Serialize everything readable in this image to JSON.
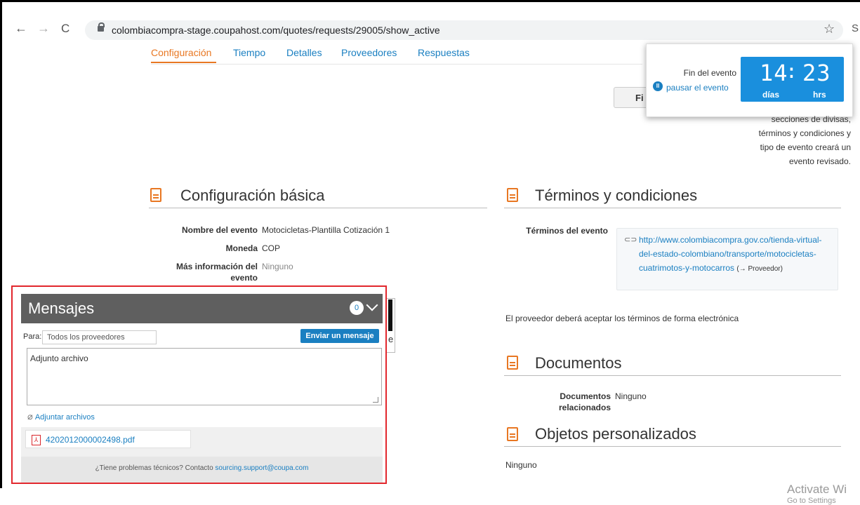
{
  "browser": {
    "url": "colombiacompra-stage.coupahost.com/quotes/requests/29005/show_active",
    "back": "←",
    "forward": "→",
    "reload": "C",
    "star": "☆",
    "extension": "S"
  },
  "tabs": [
    {
      "label": "Configuración",
      "active": true
    },
    {
      "label": "Tiempo"
    },
    {
      "label": "Detalles"
    },
    {
      "label": "Proveedores"
    },
    {
      "label": "Respuestas"
    }
  ],
  "timer": {
    "label": "Fin del evento",
    "pause_link": "pausar el evento",
    "days_value": "14",
    "hours_value": "23",
    "days_unit": "días",
    "hours_unit": "hrs",
    "background_color": "#1a8fdd"
  },
  "fin_button_label": "Fi",
  "revised_note_lines": [
    "secciones de divisas,",
    "términos y condiciones y",
    "tipo de evento creará un",
    "evento revisado."
  ],
  "basic_config": {
    "title": "Configuración básica",
    "fields": [
      {
        "label": "Nombre del evento",
        "value": "Motocicletas-Plantilla Cotización 1"
      },
      {
        "label": "Moneda",
        "value": "COP"
      },
      {
        "label": "Más información del evento",
        "value": "Ninguno"
      }
    ]
  },
  "terms": {
    "title": "Términos y condiciones",
    "label": "Términos del evento",
    "link": "http://www.colombiacompra.gov.co/tienda-virtual-del-estado-colombiano/transporte/motocicletas-cuatrimotos-y-motocarros",
    "link_note": "(→ Proveedor)",
    "accept_note": "El proveedor deberá aceptar los términos de forma electrónica"
  },
  "documents": {
    "title": "Documentos",
    "label": "Documentos relacionados",
    "value": "Ninguno"
  },
  "custom_objects": {
    "title": "Objetos personalizados",
    "value": "Ninguno"
  },
  "messages": {
    "title": "Mensajes",
    "count": "0",
    "to_label": "Para:",
    "to_value": "Todos los proveedores",
    "send_label": "Enviar un mensaje",
    "body_text": "Adjunto archivo",
    "attach_label": "Adjuntar archivos",
    "attached_file": "4202012000002498.pdf",
    "footer_text": "¿Tiene problemas técnicos? Contacto",
    "footer_email": "sourcing.support@coupa.com",
    "highlight_color": "#e2272d"
  },
  "under_panel_text": "e",
  "watermark": {
    "line1": "Activate Wi",
    "line2": "Go to Settings"
  }
}
